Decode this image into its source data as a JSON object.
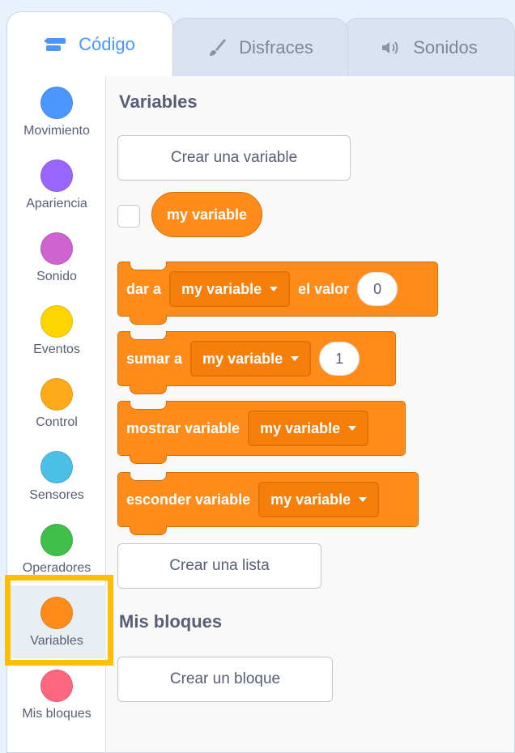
{
  "tabs": [
    {
      "label": "Código",
      "icon": "code-icon",
      "active": true
    },
    {
      "label": "Disfraces",
      "icon": "brush-icon",
      "active": false
    },
    {
      "label": "Sonidos",
      "icon": "speaker-icon",
      "active": false
    }
  ],
  "categories": [
    {
      "label": "Movimiento",
      "color": "#4c97ff"
    },
    {
      "label": "Apariencia",
      "color": "#9966ff"
    },
    {
      "label": "Sonido",
      "color": "#cf63cf"
    },
    {
      "label": "Eventos",
      "color": "#ffd500"
    },
    {
      "label": "Control",
      "color": "#ffab19"
    },
    {
      "label": "Sensores",
      "color": "#4cbfe6"
    },
    {
      "label": "Operadores",
      "color": "#40bf4a"
    },
    {
      "label": "Variables",
      "color": "#ff8c1a",
      "selected": true
    },
    {
      "label": "Mis bloques",
      "color": "#ff6680"
    }
  ],
  "palette": {
    "variables_title": "Variables",
    "create_variable": "Crear una variable",
    "reporter": "my variable",
    "set_block": {
      "prefix": "dar a",
      "variable": "my variable",
      "middle": "el valor",
      "value": "0"
    },
    "change_block": {
      "prefix": "sumar a",
      "variable": "my variable",
      "value": "1"
    },
    "show_block": {
      "prefix": "mostrar variable",
      "variable": "my variable"
    },
    "hide_block": {
      "prefix": "esconder variable",
      "variable": "my variable"
    },
    "create_list": "Crear una lista",
    "my_blocks_title": "Mis bloques",
    "create_block": "Crear un bloque"
  },
  "colors": {
    "accent": "#4c97ff",
    "variables": "#ff8c1a",
    "highlight": "#ffbf00"
  }
}
